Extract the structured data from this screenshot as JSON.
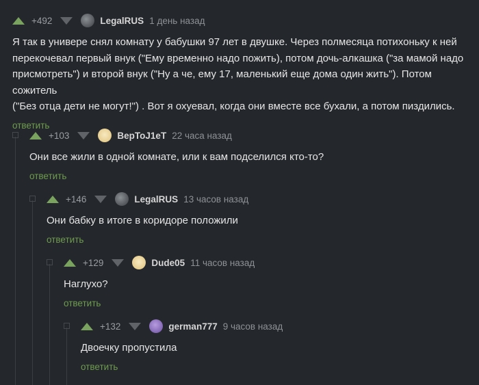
{
  "comments": [
    {
      "rating": "+492",
      "author": "LegalRUS",
      "time": "1 день назад",
      "text_lines": [
        "Я так в универе снял комнату у бабушки 97 лет в двушке. Через полмесяца потихоньку к ней",
        "перекочевал первый внук (\"Ему временно надо пожить), потом дочь-алкашка (\"за мамой надо",
        "присмотреть\") и второй внук (\"Ну а че, ему 17, маленький еще дома один жить\"). Потом сожитель",
        "(\"Без отца дети не могут!\") . Вот я охуевал, когда они вместе все бухали, а потом пиздились."
      ],
      "reply": "ответить"
    },
    {
      "rating": "+103",
      "author": "BepToJ1eT",
      "time": "22 часа назад",
      "text_lines": [
        "Они все жили в одной комнате, или к вам подселился кто-то?"
      ],
      "reply": "ответить"
    },
    {
      "rating": "+146",
      "author": "LegalRUS",
      "time": "13 часов назад",
      "text_lines": [
        "Они бабку в итоге  в коридоре положили"
      ],
      "reply": "ответить"
    },
    {
      "rating": "+129",
      "author": "Dude05",
      "time": "11 часов назад",
      "text_lines": [
        "Наглухо?"
      ],
      "reply": "ответить"
    },
    {
      "rating": "+132",
      "author": "german777",
      "time": "9 часов назад",
      "text_lines": [
        "Двоечку пропустила"
      ],
      "reply": "ответить"
    }
  ],
  "colors": {
    "background": "#24272b",
    "upvote": "#7aa35f",
    "downvote": "#606368",
    "reply_link": "#6e9c4f"
  }
}
